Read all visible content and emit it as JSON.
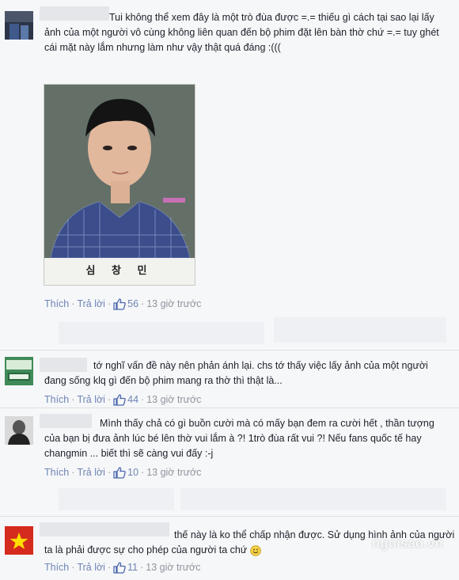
{
  "comments": [
    {
      "text": "Tui không thể xem đây là một trò đùa được =.= thiếu gì cách tại sao lại lấy ảnh của một người vô cùng không liên quan đến bộ phim đặt lên bàn thờ chứ =.= tuy ghét cái mặt này lắm nhưng làm như vậy thật quá đáng :(((",
      "photo_caption": "심 창 민",
      "like_label": "Thích",
      "reply_label": "Trả lời",
      "likes": "56",
      "time": "13 giờ trước"
    },
    {
      "text": "tớ nghĩ vấn đề này nên phản ánh lại. chs tớ thấy việc lấy ảnh của một người đang sống klq gì đến bộ phim mang ra thờ thì thật là...",
      "like_label": "Thích",
      "reply_label": "Trả lời",
      "likes": "44",
      "time": "13 giờ trước"
    },
    {
      "text": "Mình thấy chả có gì buồn cười mà có mấy bạn đem ra cười hết , thần tượng của bạn bị đưa ảnh lúc bé lên thờ vui lắm à ?! 1trò đùa rất vui ?! Nếu fans quốc tế hay changmin ... biết thì sẽ càng vui đấy :-j",
      "like_label": "Thích",
      "reply_label": "Trả lời",
      "likes": "10",
      "time": "13 giờ trước"
    },
    {
      "text": "thế này là ko thể chấp nhận được. Sử dụng hình ảnh của người ta là phải được sự cho phép của người ta chứ",
      "like_label": "Thích",
      "reply_label": "Trả lời",
      "likes": "11",
      "time": "13 giờ trước"
    }
  ],
  "watermark": "ngoisao.vn",
  "colors": {
    "link": "#6d84b4",
    "muted": "#90949c",
    "background": "#f6f7f9"
  }
}
